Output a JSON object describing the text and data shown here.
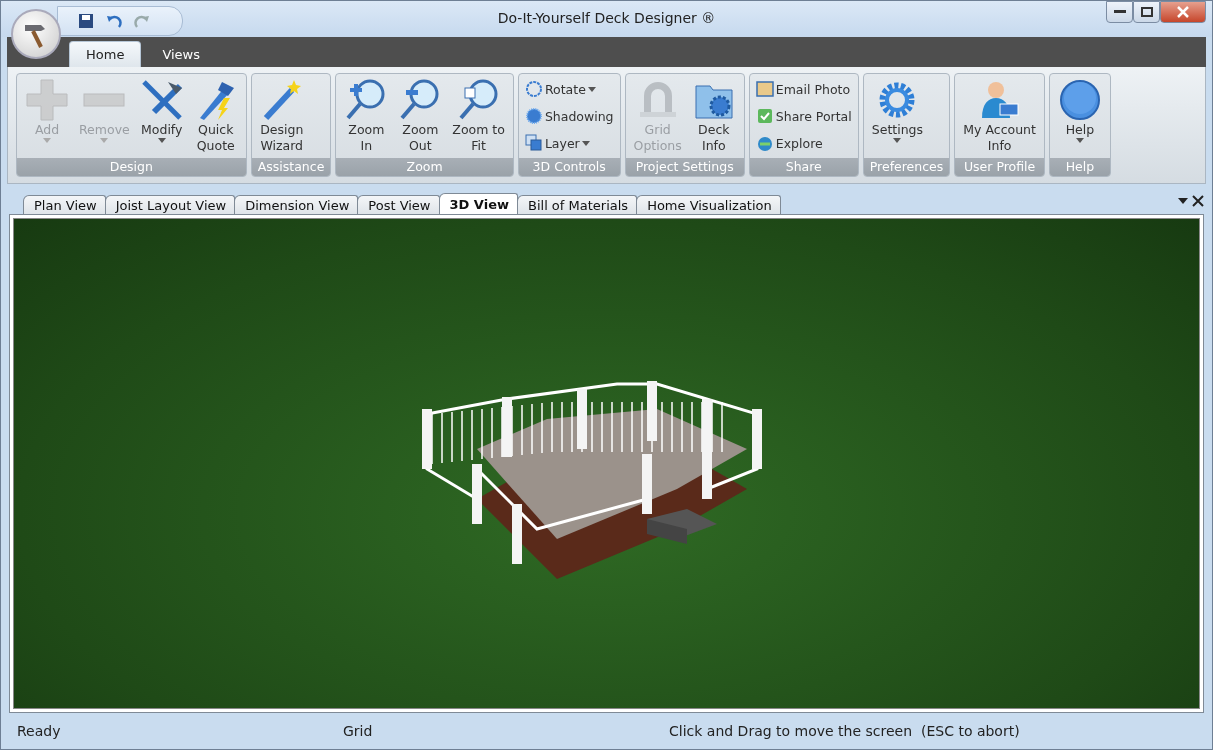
{
  "window": {
    "title": "Do-It-Yourself Deck Designer ®"
  },
  "ribbon_tabs": [
    {
      "label": "Home",
      "selected": true
    },
    {
      "label": "Views",
      "selected": false
    }
  ],
  "groups": [
    {
      "label": "Design",
      "items": [
        {
          "label": "Add",
          "kind": "large",
          "disabled": true,
          "dropdown": true
        },
        {
          "label": "Remove",
          "kind": "large",
          "disabled": true,
          "dropdown": true
        },
        {
          "label": "Modify",
          "kind": "large",
          "disabled": false,
          "dropdown": true
        },
        {
          "label": "Quick\nQuote",
          "kind": "large",
          "disabled": false,
          "dropdown": false
        }
      ]
    },
    {
      "label": "Assistance",
      "items": [
        {
          "label": "Design\nWizard",
          "kind": "large",
          "disabled": false,
          "dropdown": false
        }
      ]
    },
    {
      "label": "Zoom",
      "items": [
        {
          "label": "Zoom\nIn",
          "kind": "large",
          "disabled": false,
          "dropdown": false
        },
        {
          "label": "Zoom\nOut",
          "kind": "large",
          "disabled": false,
          "dropdown": false
        },
        {
          "label": "Zoom to\nFit",
          "kind": "large",
          "disabled": false,
          "dropdown": false
        }
      ]
    },
    {
      "label": "3D Controls",
      "items": [
        {
          "label": "Rotate",
          "kind": "small",
          "disabled": false,
          "dropdown": true
        },
        {
          "label": "Shadowing",
          "kind": "small",
          "disabled": false,
          "dropdown": false
        },
        {
          "label": "Layer",
          "kind": "small",
          "disabled": false,
          "dropdown": true
        }
      ]
    },
    {
      "label": "Project Settings",
      "items": [
        {
          "label": "Grid\nOptions",
          "kind": "large",
          "disabled": true,
          "dropdown": false
        },
        {
          "label": "Deck\nInfo",
          "kind": "large",
          "disabled": false,
          "dropdown": false
        }
      ]
    },
    {
      "label": "Share",
      "items": [
        {
          "label": "Email Photo",
          "kind": "small",
          "disabled": false,
          "dropdown": false
        },
        {
          "label": "Share Portal",
          "kind": "small",
          "disabled": false,
          "dropdown": false
        },
        {
          "label": "Explore",
          "kind": "small",
          "disabled": false,
          "dropdown": false
        }
      ]
    },
    {
      "label": "Preferences",
      "items": [
        {
          "label": "Settings",
          "kind": "large",
          "disabled": false,
          "dropdown": true
        }
      ]
    },
    {
      "label": "User Profile",
      "items": [
        {
          "label": "My Account\nInfo",
          "kind": "large",
          "disabled": false,
          "dropdown": false
        }
      ]
    },
    {
      "label": "Help",
      "items": [
        {
          "label": "Help",
          "kind": "large",
          "disabled": false,
          "dropdown": true
        }
      ]
    }
  ],
  "doc_tabs": [
    {
      "label": "Plan View",
      "selected": false
    },
    {
      "label": "Joist Layout View",
      "selected": false
    },
    {
      "label": "Dimension View",
      "selected": false
    },
    {
      "label": "Post View",
      "selected": false
    },
    {
      "label": "3D View",
      "selected": true
    },
    {
      "label": "Bill of Materials",
      "selected": false
    },
    {
      "label": "Home Visualization",
      "selected": false
    }
  ],
  "status_bar": [
    "Ready",
    "Grid",
    "Click and Drag to move the screen  (ESC to abort)"
  ]
}
